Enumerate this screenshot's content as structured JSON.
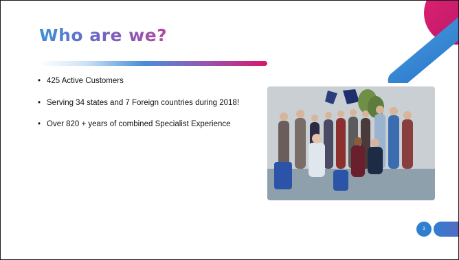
{
  "slide": {
    "title": "Who are we?",
    "bullets": [
      "425 Active Customers",
      "Serving 34 states and 7 Foreign countries during 2018!",
      "Over 820 + years of combined Specialist Experience"
    ],
    "page_number": "3"
  },
  "colors": {
    "accent_blue": "#3f8fd6",
    "accent_purple": "#6f67c4",
    "accent_magenta": "#d6196e"
  },
  "icons": [
    "team-photo"
  ]
}
